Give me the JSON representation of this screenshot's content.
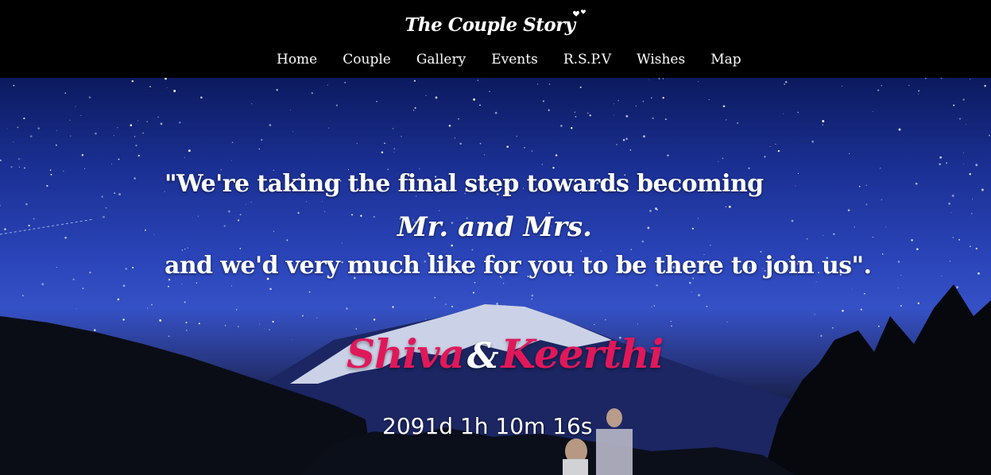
{
  "header": {
    "brand": "The Couple Story",
    "nav": [
      {
        "label": "Home"
      },
      {
        "label": "Couple"
      },
      {
        "label": "Gallery"
      },
      {
        "label": "Events"
      },
      {
        "label": "R.S.P.V"
      },
      {
        "label": "Wishes"
      },
      {
        "label": "Map"
      }
    ]
  },
  "hero": {
    "quote_line1": "\"We're taking the final step towards becoming",
    "quote_line2": "Mr. and  Mrs.",
    "quote_line3": "and we'd very much like for you to be there to join us\".",
    "groom": "Shiva",
    "ampersand": "&",
    "bride": "Keerthi",
    "countdown": "2091d 1h 10m 16s"
  },
  "colors": {
    "header_bg": "#000000",
    "accent_pink": "#e0185a",
    "text": "#ffffff"
  }
}
